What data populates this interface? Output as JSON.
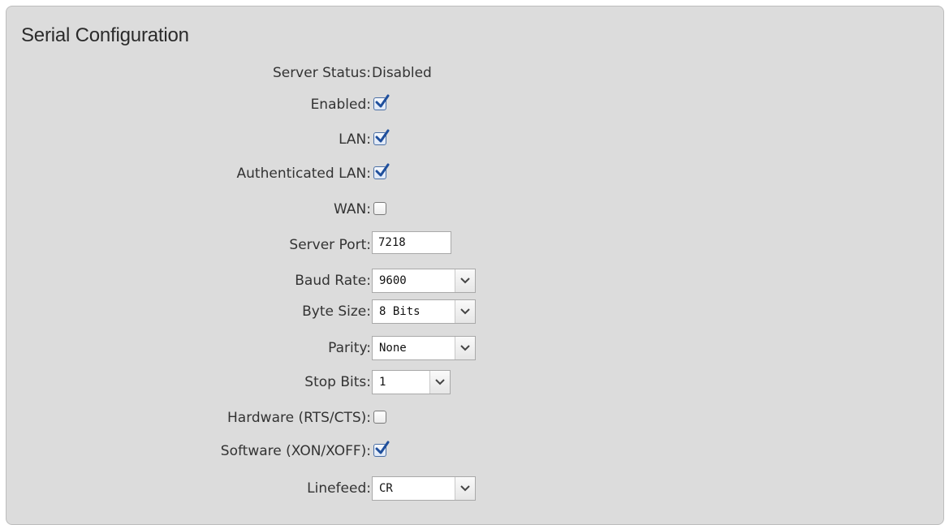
{
  "panel": {
    "title": "Serial Configuration"
  },
  "form": {
    "server_status": {
      "label": "Server Status:",
      "value": "Disabled"
    },
    "enabled": {
      "label": "Enabled:",
      "checked": true
    },
    "lan": {
      "label": "LAN:",
      "checked": true
    },
    "authenticated_lan": {
      "label": "Authenticated LAN:",
      "checked": true
    },
    "wan": {
      "label": "WAN:",
      "checked": false
    },
    "server_port": {
      "label": "Server Port:",
      "value": "7218"
    },
    "baud_rate": {
      "label": "Baud Rate:",
      "selected": "9600"
    },
    "byte_size": {
      "label": "Byte Size:",
      "selected": "8 Bits"
    },
    "parity": {
      "label": "Parity:",
      "selected": "None"
    },
    "stop_bits": {
      "label": "Stop Bits:",
      "selected": "1"
    },
    "hardware_flow": {
      "label": "Hardware (RTS/CTS):",
      "checked": false
    },
    "software_flow": {
      "label": "Software (XON/XOFF):",
      "checked": true
    },
    "linefeed": {
      "label": "Linefeed:",
      "selected": "CR"
    }
  },
  "icons": {
    "checkbox_tick": "checkmark-icon",
    "dropdown_arrow": "chevron-down-icon"
  },
  "colors": {
    "panel_background": "#dcdcdc",
    "check_accent": "#1f4f9c"
  }
}
